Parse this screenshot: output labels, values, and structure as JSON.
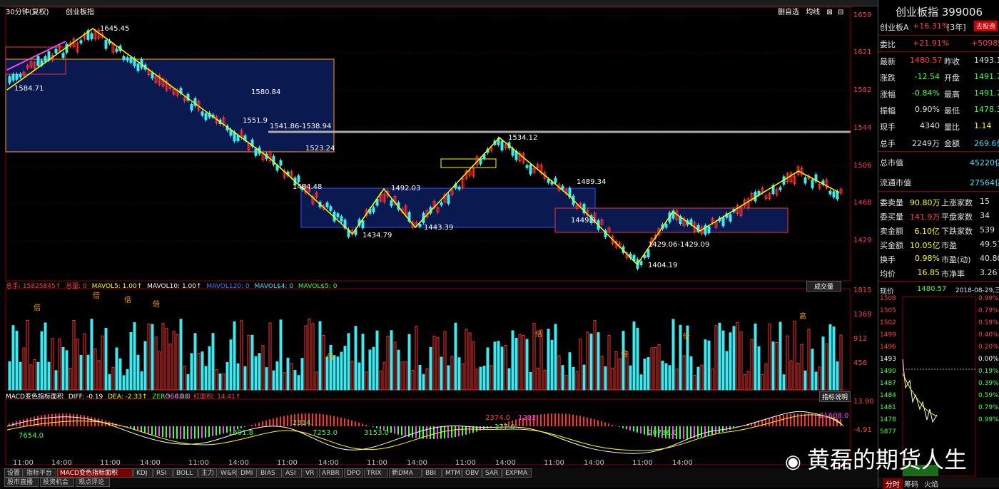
{
  "header": {
    "period": "30分钟(复权)",
    "symbol_short": "创业板指",
    "toolbar_right": [
      "删自选",
      "均线",
      "⊠",
      "⊟"
    ]
  },
  "price_axis": [
    "1659",
    "1621",
    "1582",
    "1544",
    "1506",
    "1468",
    "1429"
  ],
  "price_labels": [
    {
      "text": "1645.45"
    },
    {
      "text": "1584.71"
    },
    {
      "text": "1580.84"
    },
    {
      "text": "1551.9"
    },
    {
      "text": "1541.86-1538.94"
    },
    {
      "text": "1523.24"
    },
    {
      "text": "1484.48"
    },
    {
      "text": "1492.03"
    },
    {
      "text": "1434.79"
    },
    {
      "text": "1443.39"
    },
    {
      "text": "1534.12"
    },
    {
      "text": "1489.34"
    },
    {
      "text": "1449.9"
    },
    {
      "text": "1429.06-1429.09"
    },
    {
      "text": "1404.19"
    }
  ],
  "volume": {
    "legend": [
      {
        "text": "总手: 15825845↑",
        "color": "#ff4040"
      },
      {
        "text": "总量: 0",
        "color": "#ff4040"
      },
      {
        "text": "MAVOL5: 1.00↑",
        "color": "#ffff00"
      },
      {
        "text": "MAVOL10: 1.00↑",
        "color": "#ffffff"
      },
      {
        "text": "MAVOL120: 0",
        "color": "#4080ff"
      },
      {
        "text": "MAVOL$4: 0",
        "color": "#40e0ff"
      },
      {
        "text": "MAVOL$5: 0",
        "color": "#40ff40"
      }
    ],
    "type_label": "成交量",
    "axis": [
      "1815",
      "1369",
      "912",
      "456"
    ],
    "marks": [
      "倍",
      "倍",
      "倍",
      "倍",
      "倍",
      "倍",
      "倍",
      "倍",
      "高"
    ]
  },
  "macd": {
    "legend": [
      {
        "text": "MACD变色指标面积",
        "color": "#ffffff"
      },
      {
        "text": "DIFF: -0.19",
        "color": "#ffffff"
      },
      {
        "text": "DEA: -2.33↑",
        "color": "#ffff00"
      },
      {
        "text": "ZERO: 0.00",
        "color": "#40ff40"
      },
      {
        "text": "红面积: 14.41↑",
        "color": "#ff4040"
      }
    ],
    "help_label": "指标说明",
    "axis": [
      "13.90",
      "-4.91"
    ],
    "areas": [
      "7654.0",
      "3640.0",
      "1601.8",
      "2314.",
      "7253.0",
      "3153.0",
      "2374.0",
      "1292.",
      "177.0",
      "20786.0",
      "21608.0"
    ]
  },
  "time_axis": [
    "11:00",
    "14:00",
    "11:00",
    "14:00",
    "11:00",
    "14:00",
    "11:00",
    "14:00",
    "11:00",
    "14:00",
    "11:00",
    "14:00",
    "11:00",
    "14:00",
    "11:00",
    "14:00"
  ],
  "tabs_row1": [
    "设置",
    "指标平台",
    "MACD变色指标面积",
    "KDJ",
    "RSI",
    "BOLL",
    "主力",
    "W&R",
    "DMI",
    "BIAS",
    "ASI",
    "VR",
    "ARBR",
    "DPO",
    "TRIX",
    "新DMA",
    "BBI",
    "MTM",
    "OBV",
    "SAR",
    "EXPMA"
  ],
  "tabs_row2": [
    "股市直播",
    "投资机会",
    "观点评论"
  ],
  "right_panel": {
    "title": "创业板指 399006",
    "subtitle_name": "创业板A",
    "subtitle_change": "+16.31%",
    "subtitle_period": "[3年]",
    "badge": "去投资",
    "weibi_label": "委比",
    "weibi_value": "+21.91%",
    "weibi_diff": "+509857",
    "quotes": [
      {
        "l1": "最新",
        "v1": "1480.57",
        "c1": "#ff4040",
        "l2": "昨收",
        "v2": "1493.11",
        "c2": "#e0e0e0"
      },
      {
        "l1": "涨跌",
        "v1": "-12.54",
        "c1": "#40ff40",
        "l2": "开盘",
        "v2": "1491.78",
        "c2": "#40ff40"
      },
      {
        "l1": "涨幅",
        "v1": "-0.84%",
        "c1": "#40ff40",
        "l2": "最高",
        "v2": "1491.78",
        "c2": "#40ff40"
      },
      {
        "l1": "振幅",
        "v1": "0.90%",
        "c1": "#e0e0e0",
        "l2": "最低",
        "v2": "1478.37",
        "c2": "#40ff40"
      },
      {
        "l1": "现手",
        "v1": "4340",
        "c1": "#e0e0e0",
        "l2": "量比",
        "v2": "1.14",
        "c2": "#ffff00"
      },
      {
        "l1": "总手",
        "v1": "2249万",
        "c1": "#e0e0e0",
        "l2": "金额",
        "v2": "269.6亿",
        "c2": "#40e0ff"
      }
    ],
    "market_cap_label": "总市值",
    "market_cap_value": "45220亿",
    "float_cap_label": "流通市值",
    "float_cap_value": "27564亿",
    "stats": [
      {
        "l1": "委卖量",
        "v1": "90.80万",
        "c1": "#ffff00",
        "l2": "上涨家数",
        "v2": "15"
      },
      {
        "l1": "委买量",
        "v1": "141.9万",
        "c1": "#ff4040",
        "l2": "平盘家数",
        "v2": "34"
      },
      {
        "l1": "卖金额",
        "v1": "6.10亿",
        "c1": "#ffff00",
        "l2": "下跌家数",
        "v2": "539"
      },
      {
        "l1": "买金额",
        "v1": "10.05亿",
        "c1": "#ffff00",
        "l2": "市盈",
        "v2": "49.57"
      },
      {
        "l1": "换手",
        "v1": "0.98%",
        "c1": "#ffff00",
        "l2": "市盈(动)",
        "v2": "40.80"
      },
      {
        "l1": "均价",
        "v1": "16.85",
        "c1": "#ffff00",
        "l2": "市净率",
        "v2": "3.26"
      }
    ],
    "mini_header_label": "现价",
    "mini_header_price": "1480.57",
    "mini_header_date": "2018-08-29,三",
    "mini_axis_left": [
      "1508",
      "1505",
      "1502",
      "1499",
      "1496",
      "1493",
      "1490",
      "1487",
      "1484",
      "1481",
      "1478",
      "5877"
    ],
    "mini_axis_right": [
      "0.99%",
      "0.79%",
      "0.59%",
      "0.40%",
      "0.20%",
      "0.00%",
      "0.19%",
      "0.39%",
      "0.59%",
      "0.79%",
      "0.99%"
    ],
    "bottom_tabs": [
      "分时",
      "筹码",
      "火焰"
    ]
  },
  "watermark": "黄磊的期货人生",
  "colors": {
    "up": "#ff3030",
    "down": "#40e8f0",
    "box": "#ffa500",
    "fill": "#0a1a50",
    "zigzag": "#ffff00"
  }
}
